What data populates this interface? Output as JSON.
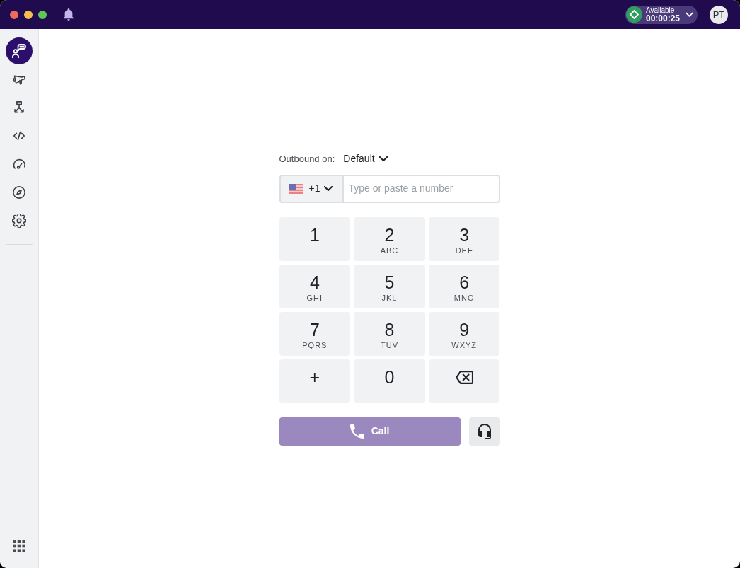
{
  "title_bar": {
    "status": {
      "label": "Available",
      "timer": "00:00:25"
    },
    "avatar": {
      "initials": "PT"
    }
  },
  "sidebar": {
    "items": [
      {
        "selected": true
      },
      {
        "selected": false
      },
      {
        "selected": false
      },
      {
        "selected": false
      },
      {
        "selected": false
      },
      {
        "selected": false
      },
      {
        "selected": false
      }
    ]
  },
  "dialer": {
    "outbound_label": "Outbound on:",
    "outbound_value": "Default",
    "country_code": "+1",
    "placeholder": "Type or paste a number",
    "keys": [
      {
        "kind": "digit",
        "digit": "1"
      },
      {
        "kind": "digit",
        "digit": "2",
        "letters": "ABC"
      },
      {
        "kind": "digit",
        "digit": "3",
        "letters": "DEF"
      },
      {
        "kind": "digit",
        "digit": "4",
        "letters": "GHI"
      },
      {
        "kind": "digit",
        "digit": "5",
        "letters": "JKL"
      },
      {
        "kind": "digit",
        "digit": "6",
        "letters": "MNO"
      },
      {
        "kind": "digit",
        "digit": "7",
        "letters": "PQRS"
      },
      {
        "kind": "digit",
        "digit": "8",
        "letters": "TUV"
      },
      {
        "kind": "digit",
        "digit": "9",
        "letters": "WXYZ"
      },
      {
        "kind": "digit",
        "digit": "+"
      },
      {
        "kind": "digit",
        "digit": "0"
      },
      {
        "kind": "backspace"
      }
    ],
    "call_button": {
      "label": "Call",
      "disabled": true
    }
  }
}
